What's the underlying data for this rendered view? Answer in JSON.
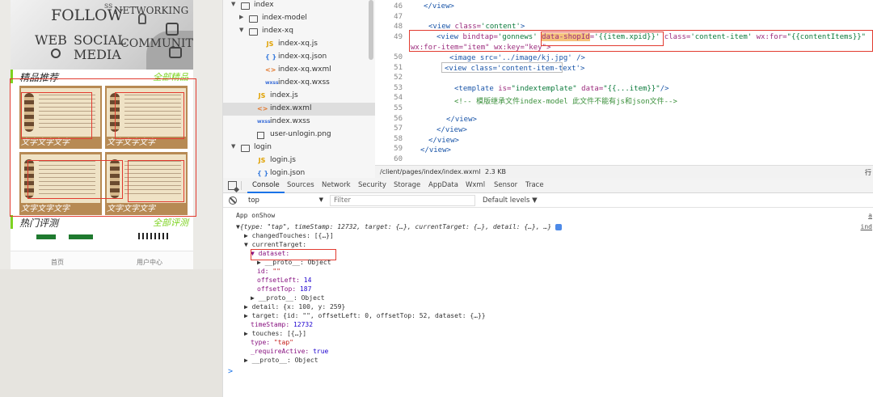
{
  "simulator": {
    "banner_words": [
      "FOLLOW",
      "NETWORKING",
      "WEB",
      "SOCIAL",
      "COMMUNITY",
      "MEDIA",
      "ss"
    ],
    "section1": {
      "title": "精品推荐",
      "more": "全部精品"
    },
    "section2": {
      "title": "热门评测",
      "more": "全部评测"
    },
    "tiles": [
      {
        "caption": "文字文字文字"
      },
      {
        "caption": "文字文字文字"
      },
      {
        "caption": "文字文字文字"
      },
      {
        "caption": "文字文字文字"
      }
    ],
    "tabbar": [
      "首页",
      "用户中心"
    ]
  },
  "file_tree": [
    {
      "toggle": "▼",
      "icon": "folder",
      "name": "index",
      "level": 1
    },
    {
      "toggle": "▶",
      "icon": "folder",
      "name": "index-model",
      "level": 2
    },
    {
      "toggle": "▼",
      "icon": "folder",
      "name": "index-xq",
      "level": 2
    },
    {
      "toggle": "",
      "icon": "js",
      "label": "JS",
      "name": "index-xq.js",
      "level": 3
    },
    {
      "toggle": "",
      "icon": "json",
      "label": "{ }",
      "name": "index-xq.json",
      "level": 3
    },
    {
      "toggle": "",
      "icon": "wxml",
      "label": "<>",
      "name": "index-xq.wxml",
      "level": 3
    },
    {
      "toggle": "",
      "icon": "wxss",
      "label": "wxss",
      "name": "index-xq.wxss",
      "level": 3
    },
    {
      "toggle": "",
      "icon": "js",
      "label": "JS",
      "name": "index.js",
      "level": 2
    },
    {
      "toggle": "",
      "icon": "wxml",
      "label": "<>",
      "name": "index.wxml",
      "level": 2,
      "selected": true
    },
    {
      "toggle": "",
      "icon": "wxss",
      "label": "wxss",
      "name": "index.wxss",
      "level": 2
    },
    {
      "toggle": "",
      "icon": "png",
      "label": "",
      "name": "user-unlogin.png",
      "level": 2
    },
    {
      "toggle": "▼",
      "icon": "folder",
      "name": "login",
      "level": 1
    },
    {
      "toggle": "",
      "icon": "js",
      "label": "JS",
      "name": "login.js",
      "level": 2
    },
    {
      "toggle": "",
      "icon": "json",
      "label": "{ }",
      "name": "login.json",
      "level": 2
    }
  ],
  "editor": {
    "line_numbers": [
      "46",
      "47",
      "48",
      "49",
      "",
      "50",
      "51",
      "52",
      "53",
      "54",
      "55",
      "56",
      "57",
      "58",
      "59",
      "60"
    ],
    "code": {
      "l46": "</view>",
      "l48a": "<view ",
      "l48b": "class=",
      "l48c": "'content'",
      "l48d": ">",
      "l49a": "<view ",
      "l49b": "bindtap=",
      "l49c": "'gonnews'",
      "l49d": "data-shopId",
      "l49e": "=",
      "l49f": "'{{item.xpid}}'",
      "l49g": " class=",
      "l49h": "'content-item'",
      "l49i": " wx:for=",
      "l49j": "\"{{contentItems}}\"",
      "l49w": "wx:for-item=\"item\" wx:key=\"key\">",
      "l50": "<image src='../image/kj.jpg' />",
      "l51": "<view class='content-item-text'>",
      "l53a": "<template ",
      "l53b": "is=",
      "l53c": "\"indextemplate\"",
      "l53d": " data=",
      "l53e": "\"{{...item}}\"",
      "l53f": "/>",
      "l54": "<!-- 模版继承文件index-model 此文件不能有js和json文件-->",
      "l56": "</view>",
      "l57": "</view>",
      "l58": "</view>",
      "l59": "</view>"
    },
    "status": {
      "path": "/client/pages/index/index.wxml",
      "size": "2.3 KB",
      "trail": "行"
    }
  },
  "devtools": {
    "tabs": [
      "Console",
      "Sources",
      "Network",
      "Security",
      "Storage",
      "AppData",
      "Wxml",
      "Sensor",
      "Trace"
    ],
    "active_tab": "Console",
    "context": "top",
    "filter_placeholder": "Filter",
    "levels": "Default levels ▼",
    "console": {
      "l0": "App onShow",
      "l0r": "a",
      "l1": "▼{type: \"tap\", timeStamp: 12732, target: {…}, currentTarget: {…}, detail: {…}, …}",
      "l1r": "ind",
      "l2": "▶ changedTouches: [{…}]",
      "l3": "▼ currentTarget:",
      "l4": "▼ dataset:",
      "l5": "▶ __proto__: Object",
      "l6a": "id: ",
      "l6b": "\"\"",
      "l7a": "offsetLeft: ",
      "l7b": "14",
      "l8a": "offsetTop: ",
      "l8b": "187",
      "l9": "▶ __proto__: Object",
      "l10": "▶ detail: {x: 100, y: 259}",
      "l11": "▶ target: {id: \"\", offsetLeft: 0, offsetTop: 52, dataset: {…}}",
      "l12a": "timeStamp: ",
      "l12b": "12732",
      "l13": "▶ touches: [{…}]",
      "l14a": "type: ",
      "l14b": "\"tap\"",
      "l15a": "_requireActive: ",
      "l15b": "true",
      "l16": "▶ __proto__: Object",
      "prompt": ">"
    }
  }
}
